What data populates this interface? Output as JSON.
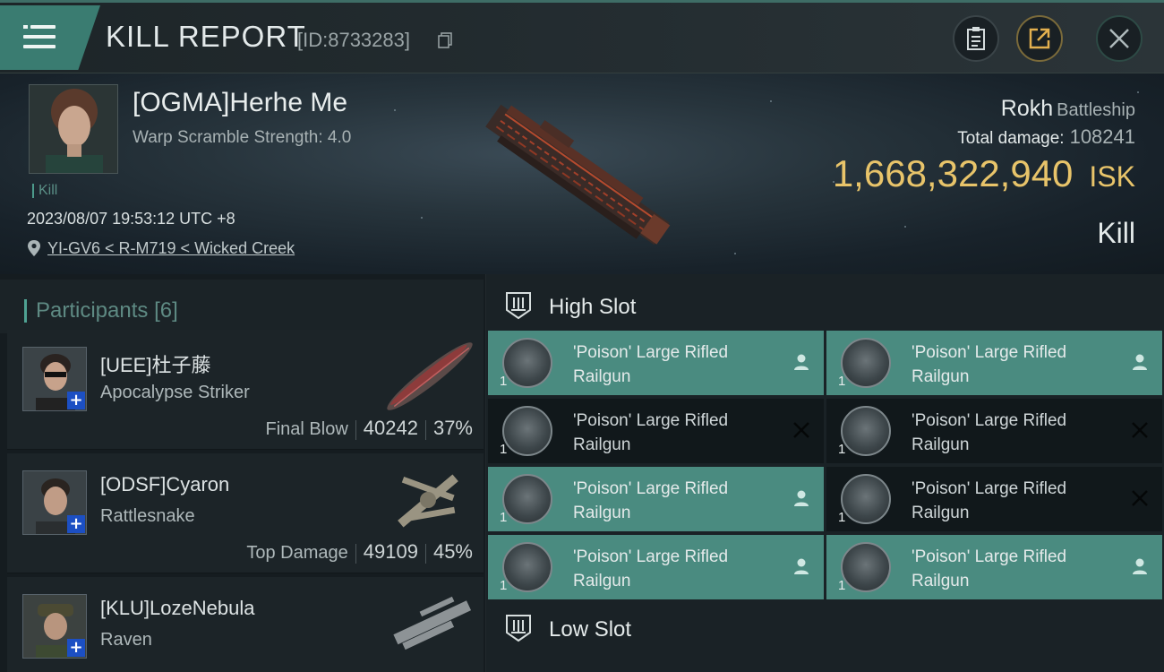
{
  "header": {
    "title": "KILL REPORT",
    "report_id": "[ID:8733283]"
  },
  "victim": {
    "name": "[OGMA]Herhe Me",
    "warp_scramble": "Warp Scramble Strength: 4.0",
    "tag": "Kill",
    "datetime": "2023/08/07 19:53:12 UTC +8",
    "location": "YI-GV6 < R-M719 < Wicked Creek",
    "ship": "Rokh",
    "ship_class": "Battleship",
    "total_damage_label": "Total damage:",
    "total_damage": "108241",
    "isk_value": "1,668,322,940",
    "isk_unit": "ISK",
    "result": "Kill"
  },
  "participants": {
    "label": "Participants",
    "count": "[6]",
    "items": [
      {
        "name": "[UEE]杜子藤",
        "ship": "Apocalypse Striker",
        "role": "Final Blow",
        "damage": "40242",
        "percent": "37%"
      },
      {
        "name": "[ODSF]Cyaron",
        "ship": "Rattlesnake",
        "role": "Top Damage",
        "damage": "49109",
        "percent": "45%"
      },
      {
        "name": "[KLU]LozeNebula",
        "ship": "Raven",
        "role": "",
        "damage": "",
        "percent": ""
      }
    ]
  },
  "fittings": {
    "high_slot_label": "High Slot",
    "low_slot_label": "Low Slot",
    "modules": [
      {
        "name": "'Poison' Large Rifled Railgun",
        "qty": "1",
        "status": "dropped"
      },
      {
        "name": "'Poison' Large Rifled Railgun",
        "qty": "1",
        "status": "dropped"
      },
      {
        "name": "'Poison' Large Rifled Railgun",
        "qty": "1",
        "status": "destroyed"
      },
      {
        "name": "'Poison' Large Rifled Railgun",
        "qty": "1",
        "status": "destroyed"
      },
      {
        "name": "'Poison' Large Rifled Railgun",
        "qty": "1",
        "status": "dropped"
      },
      {
        "name": "'Poison' Large Rifled Railgun",
        "qty": "1",
        "status": "destroyed"
      },
      {
        "name": "'Poison' Large Rifled Railgun",
        "qty": "1",
        "status": "dropped"
      },
      {
        "name": "'Poison' Large Rifled Railgun",
        "qty": "1",
        "status": "dropped"
      }
    ]
  },
  "colors": {
    "accent": "#4a8b80",
    "isk": "#e8c46a",
    "badge": "#1c4fc3"
  }
}
